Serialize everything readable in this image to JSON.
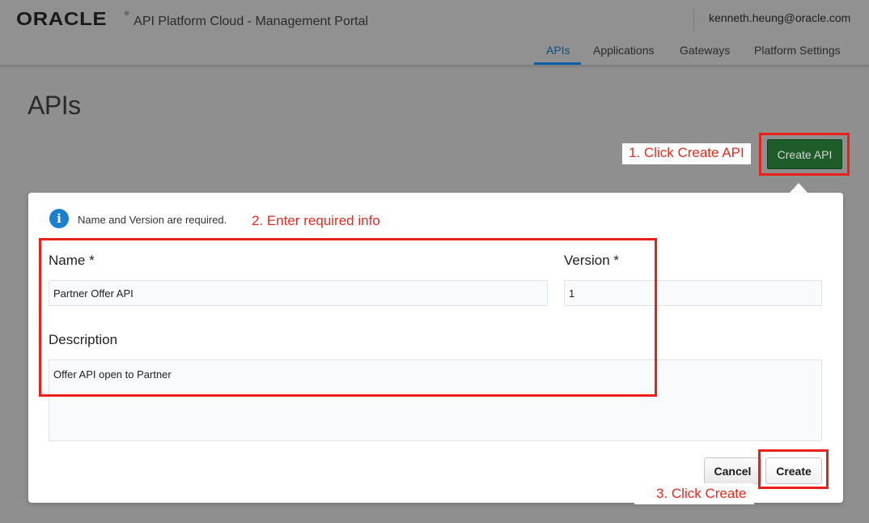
{
  "header": {
    "logo": "ORACLE",
    "logo_mark": "®",
    "app_title": "API Platform Cloud - Management Portal",
    "user_email": "kenneth.heung@oracle.com",
    "nav": [
      {
        "label": "APIs",
        "active": true
      },
      {
        "label": "Applications",
        "active": false
      },
      {
        "label": "Gateways",
        "active": false
      },
      {
        "label": "Platform Settings",
        "active": false
      }
    ]
  },
  "page": {
    "title": "APIs",
    "create_api_label": "Create API"
  },
  "annotations": {
    "step1": "1. Click Create API",
    "step2": "2. Enter required info",
    "step3": "3. Click Create",
    "color": "#e52b1c"
  },
  "dialog": {
    "info_icon": "info-icon",
    "info_text": "Name and Version are required.",
    "name_label": "Name *",
    "name_value": "Partner Offer API",
    "version_label": "Version *",
    "version_value": "1",
    "description_label": "Description",
    "description_value": "Offer API open to Partner",
    "cancel_label": "Cancel",
    "create_label": "Create"
  },
  "colors": {
    "create_api_button": "#1e5c2a",
    "nav_active": "#0b5ea8",
    "info_icon": "#1b7fd0",
    "overlay": "#8f8f8f"
  }
}
